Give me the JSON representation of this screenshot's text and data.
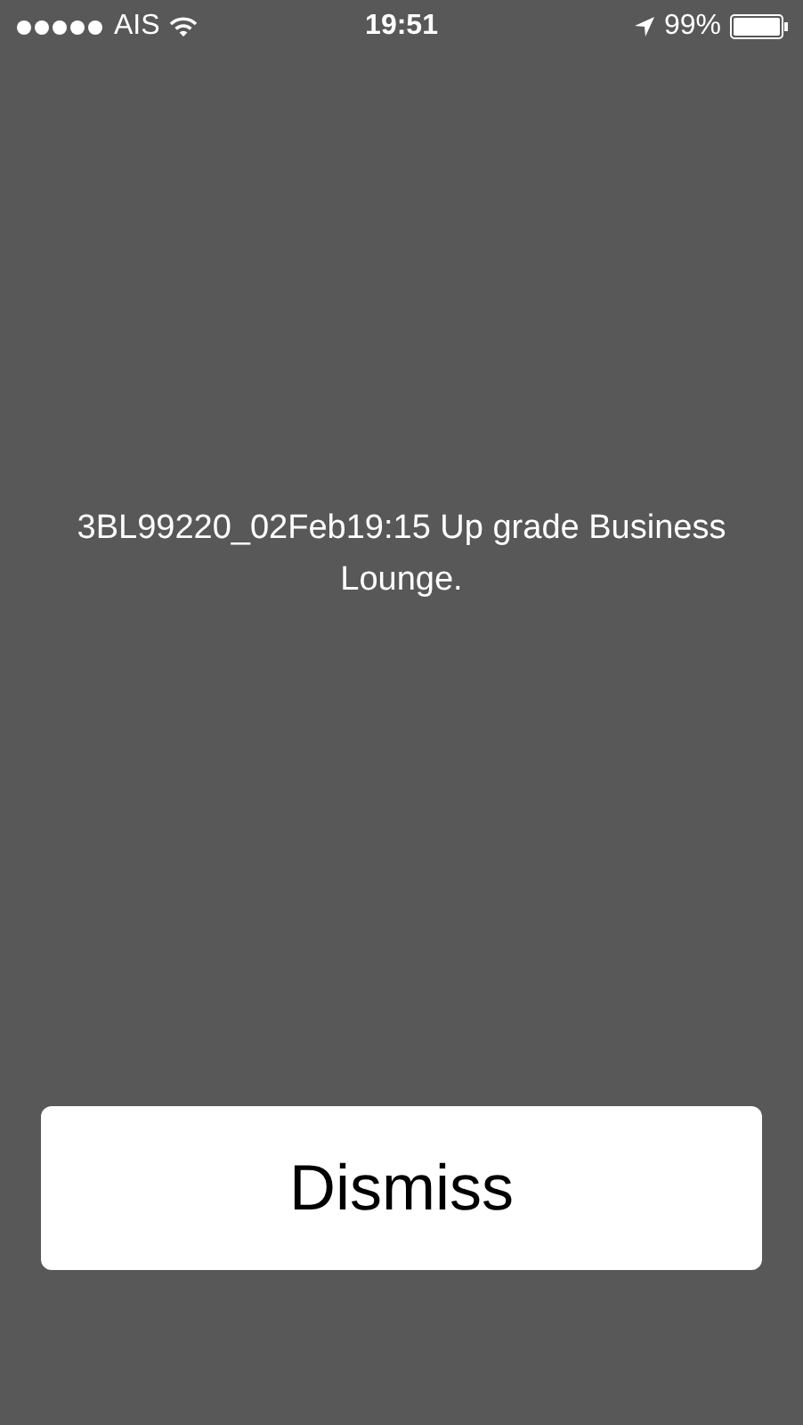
{
  "status_bar": {
    "carrier": "AIS",
    "time": "19:51",
    "battery": "99%"
  },
  "message": "3BL99220_02Feb19:15 Up grade Business Lounge.",
  "buttons": [
    {
      "label": "Dismiss"
    }
  ]
}
